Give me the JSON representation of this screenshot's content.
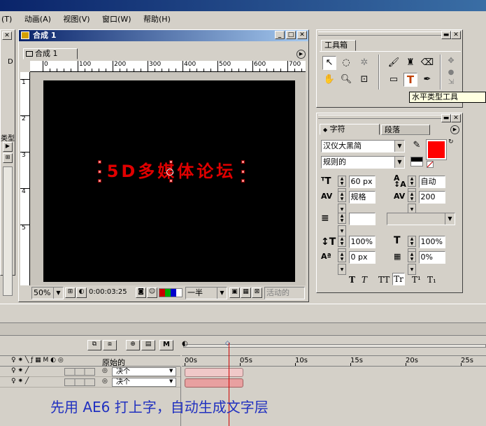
{
  "menubar": {
    "items": [
      "(T)",
      "动画(A)",
      "视图(V)",
      "窗口(W)",
      "帮助(H)"
    ]
  },
  "left_panel": {
    "label_d": "D",
    "label_type": "类型"
  },
  "comp_window": {
    "title": "合成 1",
    "tab": "合成 1",
    "ruler_labels": [
      "0",
      "100",
      "200",
      "300",
      "400",
      "500",
      "600",
      "700"
    ],
    "vruler_labels": [
      "1",
      "2",
      "3",
      "4",
      "5"
    ],
    "canvas_text": "5D多媒体论坛",
    "zoom": "50%",
    "timecode": "0:00:03:25",
    "resolution": "一半",
    "active_camera": "活动的"
  },
  "toolbox": {
    "title": "工具箱",
    "tooltip": "水平类型工具"
  },
  "character_panel": {
    "tabs": [
      "字符",
      "段落"
    ],
    "font": "汉仪大黑简",
    "style": "规则的",
    "size": "60 px",
    "leading": "自动",
    "kerning": "规格",
    "tracking": "200",
    "vscale": "100%",
    "hscale": "100%",
    "baseline": "0 px",
    "tsume": "0%",
    "text_color": "#ff0000",
    "stroke_color": "#000000",
    "style_buttons": [
      "T",
      "T",
      "TT",
      "Tr",
      "T¹",
      "T₁"
    ]
  },
  "timeline": {
    "column_header": "原始的",
    "layers": [
      {
        "name": "决个"
      },
      {
        "name": "决个"
      }
    ],
    "time_labels": [
      "00s",
      "05s",
      "10s",
      "15s",
      "20s",
      "25s"
    ],
    "caption": "先用 AE6 打上字，自动生成文字层"
  }
}
